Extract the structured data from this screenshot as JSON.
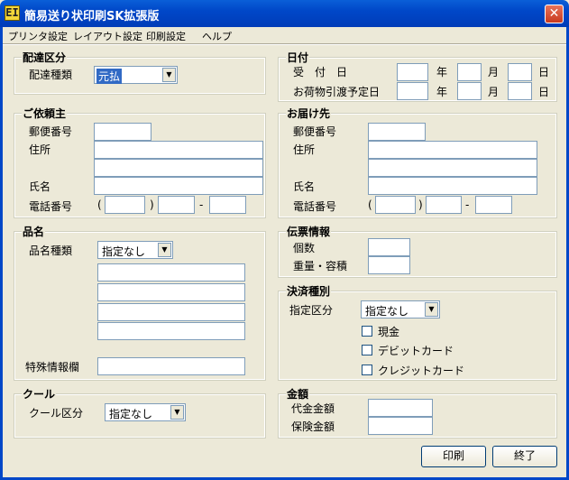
{
  "window": {
    "title": "簡易送り状印刷SK拡張版",
    "icon_text": "EI",
    "close_glyph": "✕"
  },
  "menu": [
    "プリンタ設定",
    "レイアウト設定",
    "印刷設定",
    "ヘルプ"
  ],
  "delivery": {
    "title": "配達区分",
    "type_label": "配達種類",
    "type_value": "元払"
  },
  "date": {
    "title": "日付",
    "received_label": "受　付　日",
    "planned_label": "お荷物引渡予定日",
    "year": "年",
    "month": "月",
    "day": "日"
  },
  "client": {
    "title": "ご依頼主",
    "postal_label": "郵便番号",
    "address_label": "住所",
    "name_label": "氏名",
    "phone_label": "電話番号",
    "paren_open": "(",
    "paren_close": ")",
    "dash": "-"
  },
  "recipient": {
    "title": "お届け先",
    "postal_label": "郵便番号",
    "address_label": "住所",
    "name_label": "氏名",
    "phone_label": "電話番号",
    "paren_open": "(",
    "paren_close": ")",
    "dash": "-"
  },
  "product": {
    "title": "品名",
    "type_label": "品名種類",
    "type_value": "指定なし",
    "special_label": "特殊情報欄"
  },
  "slip": {
    "title": "伝票情報",
    "count_label": "個数",
    "weight_label": "重量・容積"
  },
  "payment": {
    "title": "決済種別",
    "type_label": "指定区分",
    "type_value": "指定なし",
    "cash": "現金",
    "debit": "デビットカード",
    "credit": "クレジットカード"
  },
  "cool": {
    "title": "クール",
    "type_label": "クール区分",
    "type_value": "指定なし"
  },
  "amount": {
    "title": "金額",
    "cod_label": "代金金額",
    "insurance_label": "保険金額"
  },
  "buttons": {
    "print": "印刷",
    "exit": "終了"
  }
}
